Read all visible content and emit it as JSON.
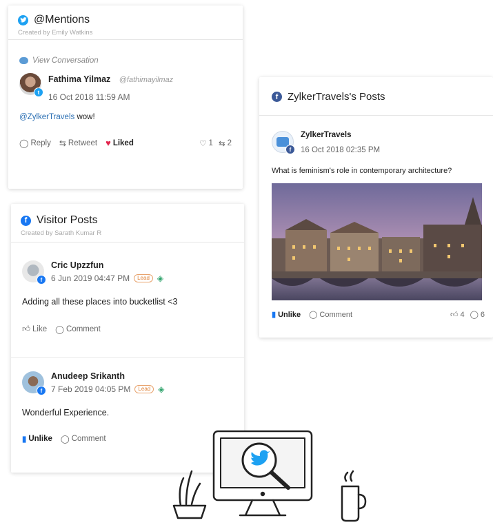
{
  "mentions_card": {
    "title": "@Mentions",
    "created_by": "Created by Emily Watkins",
    "view_conversation": "View Conversation",
    "author_name": "Fathima Yilmaz",
    "author_handle": "@fathimayilmaz",
    "timestamp": "16 Oct 2018 11:59 AM",
    "mention": "@ZylkerTravels",
    "message": " wow!",
    "actions": {
      "reply": "Reply",
      "retweet": "Retweet",
      "liked": "Liked",
      "like_count": "1",
      "retweet_count": "2"
    }
  },
  "visitor_card": {
    "title": "Visitor Posts",
    "created_by": "Created by Sarath Kumar R",
    "posts": [
      {
        "author_name": "Cric Upzzfun",
        "timestamp": "6 Jun 2019 04:47 PM",
        "lead_badge": "Lead",
        "message": "Adding all these places into bucketlist <3",
        "like_label": "Like",
        "comment_label": "Comment"
      },
      {
        "author_name": "Anudeep Srikanth",
        "timestamp": "7 Feb 2019 04:05 PM",
        "lead_badge": "Lead",
        "message": "Wonderful Experience.",
        "like_label": "Unlike",
        "comment_label": "Comment"
      }
    ]
  },
  "zylker_card": {
    "title": "ZylkerTravels's Posts",
    "author_name": "ZylkerTravels",
    "timestamp": "16 Oct 2018 02:35 PM",
    "message": "What is feminism's role in contemporary architecture?",
    "actions": {
      "unlike": "Unlike",
      "comment": "Comment",
      "like_count": "4",
      "comment_count": "6"
    }
  },
  "colors": {
    "twitter": "#1da1f2",
    "facebook": "#1877f2",
    "liked_heart": "#e2264d",
    "lead": "#e0843b"
  }
}
